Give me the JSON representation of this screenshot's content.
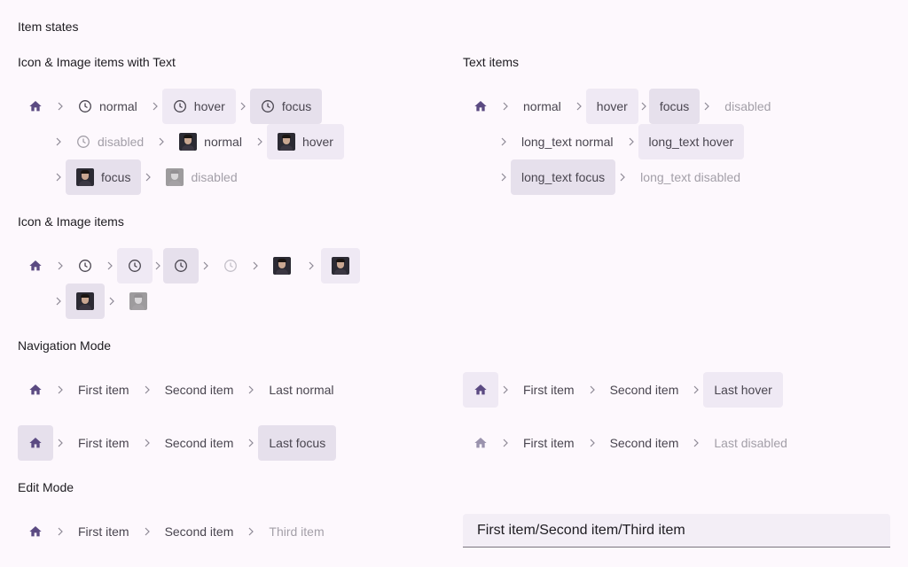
{
  "page_title": "Item states",
  "sections": {
    "icon_image_text": "Icon & Image items with Text",
    "text_items": "Text items",
    "icon_image": "Icon & Image items",
    "navigation_mode": "Navigation Mode",
    "edit_mode": "Edit Mode"
  },
  "icon_image_text": {
    "icon_normal": "normal",
    "icon_hover": "hover",
    "icon_focus": "focus",
    "icon_disabled": "disabled",
    "img_normal": "normal",
    "img_hover": "hover",
    "img_focus": "focus",
    "img_disabled": "disabled"
  },
  "text_items": {
    "normal": "normal",
    "hover": "hover",
    "focus": "focus",
    "disabled": "disabled",
    "long_normal": "long_text normal",
    "long_hover": "long_text hover",
    "long_focus": "long_text focus",
    "long_disabled": "long_text disabled"
  },
  "navigation": {
    "first": "First item",
    "second": "Second item",
    "last_normal": "Last normal",
    "last_hover": "Last hover",
    "last_focus": "Last focus",
    "last_disabled": "Last disabled"
  },
  "edit": {
    "first": "First item",
    "second": "Second item",
    "third": "Third item",
    "field_value": "First item/Second item/Third item"
  },
  "icons": {
    "home": "home-icon",
    "separator": "chevron-right-icon",
    "clock": "clock-icon",
    "avatar": "avatar-image"
  },
  "colors": {
    "background": "#fdf8fd",
    "hover_bg": "#efe9f4",
    "focus_bg": "#e6e0ec",
    "accent": "#5b4a82",
    "text": "#49454f",
    "disabled": "#a39fa8"
  }
}
